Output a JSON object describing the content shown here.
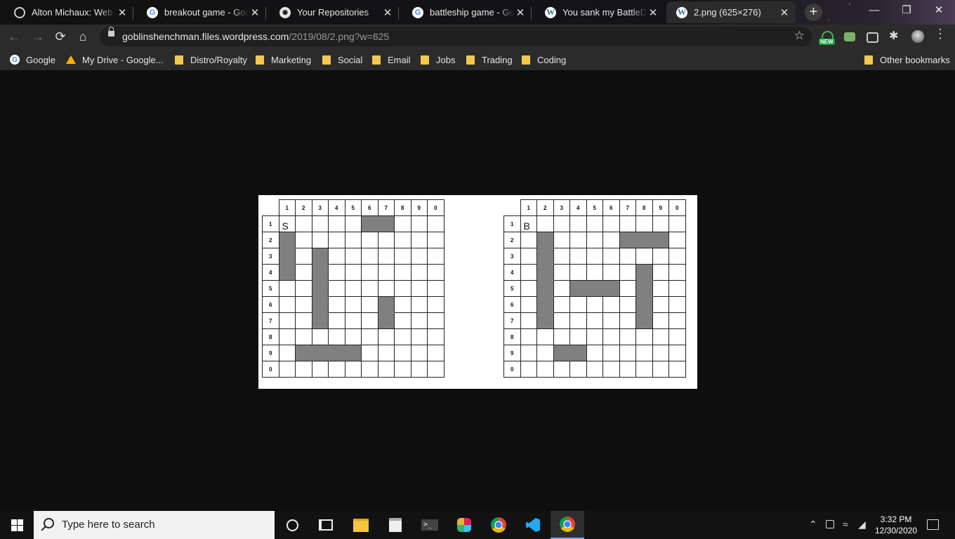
{
  "browser": {
    "tabs": [
      {
        "title": "Alton Michaux: Web D",
        "favicon": "globe-icon",
        "active": false
      },
      {
        "title": "breakout game - Goog",
        "favicon": "google-icon",
        "active": false
      },
      {
        "title": "Your Repositories",
        "favicon": "github-icon",
        "active": false
      },
      {
        "title": "battleship game - Goo",
        "favicon": "google-icon",
        "active": false
      },
      {
        "title": "You sank my BattleDu",
        "favicon": "wordpress-icon",
        "active": false
      },
      {
        "title": "2.png (625×276)",
        "favicon": "wordpress-icon",
        "active": true
      }
    ],
    "new_tab_label": "+",
    "address": {
      "host": "goblinshenchman.files.wordpress.com",
      "path": "/2019/08/2.png?w=625"
    },
    "extension_badge": "NEW",
    "bookmarks": [
      {
        "label": "Google",
        "icon": "google-icon"
      },
      {
        "label": "My Drive - Google...",
        "icon": "drive-icon"
      },
      {
        "label": "Distro/Royalty",
        "icon": "folder-icon"
      },
      {
        "label": "Marketing",
        "icon": "folder-icon"
      },
      {
        "label": "Social",
        "icon": "folder-icon"
      },
      {
        "label": "Email",
        "icon": "folder-icon"
      },
      {
        "label": "Jobs",
        "icon": "folder-icon"
      },
      {
        "label": "Trading",
        "icon": "folder-icon"
      },
      {
        "label": "Coding",
        "icon": "folder-icon"
      }
    ],
    "other_bookmarks": "Other bookmarks"
  },
  "image": {
    "col_labels": [
      "1",
      "2",
      "3",
      "4",
      "5",
      "6",
      "7",
      "8",
      "9",
      "0"
    ],
    "row_labels": [
      "1",
      "2",
      "3",
      "4",
      "5",
      "6",
      "7",
      "8",
      "9",
      "0"
    ],
    "boards": [
      {
        "marker": "S",
        "ships": [
          [
            1,
            6
          ],
          [
            1,
            7
          ],
          [
            2,
            1
          ],
          [
            3,
            1
          ],
          [
            4,
            1
          ],
          [
            3,
            3
          ],
          [
            4,
            3
          ],
          [
            5,
            3
          ],
          [
            6,
            3
          ],
          [
            7,
            3
          ],
          [
            6,
            7
          ],
          [
            7,
            7
          ],
          [
            9,
            2
          ],
          [
            9,
            3
          ],
          [
            9,
            4
          ],
          [
            9,
            5
          ]
        ]
      },
      {
        "marker": "B",
        "ships": [
          [
            2,
            2
          ],
          [
            3,
            2
          ],
          [
            4,
            2
          ],
          [
            5,
            2
          ],
          [
            6,
            2
          ],
          [
            7,
            2
          ],
          [
            2,
            7
          ],
          [
            2,
            8
          ],
          [
            2,
            9
          ],
          [
            4,
            8
          ],
          [
            5,
            8
          ],
          [
            6,
            8
          ],
          [
            7,
            8
          ],
          [
            5,
            4
          ],
          [
            5,
            5
          ],
          [
            5,
            6
          ],
          [
            9,
            3
          ],
          [
            9,
            4
          ]
        ]
      }
    ]
  },
  "taskbar": {
    "search_placeholder": "Type here to search",
    "apps": [
      "cortana-icon",
      "task-view-icon",
      "file-explorer-icon",
      "store-icon",
      "terminal-icon",
      "slack-icon",
      "chrome-icon",
      "vscode-icon",
      "chrome-profile-icon"
    ],
    "time": "3:32 PM",
    "date": "12/30/2020"
  }
}
